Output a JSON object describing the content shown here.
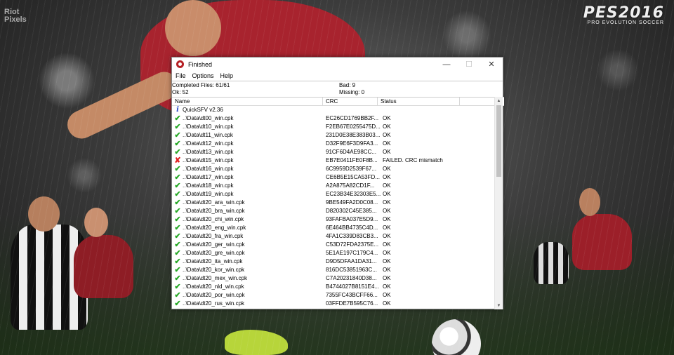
{
  "brand": {
    "title": "PES2016",
    "subtitle": "PRO EVOLUTION SOCCER"
  },
  "watermark": {
    "line1": "Riot",
    "line2": "Pixels"
  },
  "window": {
    "title": "Finished",
    "controls": {
      "minimize": "—",
      "maximize": "☐",
      "close": "✕"
    }
  },
  "menu": {
    "file": "File",
    "options": "Options",
    "help": "Help"
  },
  "stats": {
    "completed": "Completed Files: 61/61",
    "ok": "Ok: 52",
    "bad": "Bad: 9",
    "missing": "Missing: 0"
  },
  "columns": {
    "name": "Name",
    "crc": "CRC",
    "status": "Status"
  },
  "rows": [
    {
      "icon": "info-icon",
      "name": "QuickSFV v2.36",
      "crc": "",
      "status": ""
    },
    {
      "icon": "check-icon",
      "name": "..\\Data\\dt00_win.cpk",
      "crc": "EC26CD1769BB2F...",
      "status": "OK"
    },
    {
      "icon": "check-icon",
      "name": "..\\Data\\dt10_win.cpk",
      "crc": "F2EB67E0255475D...",
      "status": "OK"
    },
    {
      "icon": "check-icon",
      "name": "..\\Data\\dt11_win.cpk",
      "crc": "231D0E38E383B03...",
      "status": "OK"
    },
    {
      "icon": "check-icon",
      "name": "..\\Data\\dt12_win.cpk",
      "crc": "D32F9E6F3D9FA3...",
      "status": "OK"
    },
    {
      "icon": "check-icon",
      "name": "..\\Data\\dt13_win.cpk",
      "crc": "91CF6D4AE98CC...",
      "status": "OK"
    },
    {
      "icon": "cross-icon",
      "name": "..\\Data\\dt15_win.cpk",
      "crc": "EB7E0411FE0F8B...",
      "status": "FAILED.  CRC mismatch"
    },
    {
      "icon": "check-icon",
      "name": "..\\Data\\dt16_win.cpk",
      "crc": "6C9959D2539F67...",
      "status": "OK"
    },
    {
      "icon": "check-icon",
      "name": "..\\Data\\dt17_win.cpk",
      "crc": "CE6B5E15CA53FD...",
      "status": "OK"
    },
    {
      "icon": "check-icon",
      "name": "..\\Data\\dt18_win.cpk",
      "crc": "A2A875A82CD1F...",
      "status": "OK"
    },
    {
      "icon": "check-icon",
      "name": "..\\Data\\dt19_win.cpk",
      "crc": "EC23B34E32303E5...",
      "status": "OK"
    },
    {
      "icon": "check-icon",
      "name": "..\\Data\\dt20_ara_win.cpk",
      "crc": "9BE549FA2D0C08...",
      "status": "OK"
    },
    {
      "icon": "check-icon",
      "name": "..\\Data\\dt20_bra_win.cpk",
      "crc": "D820302C45E385...",
      "status": "OK"
    },
    {
      "icon": "check-icon",
      "name": "..\\Data\\dt20_chi_win.cpk",
      "crc": "93FAFBA037E5D9...",
      "status": "OK"
    },
    {
      "icon": "check-icon",
      "name": "..\\Data\\dt20_eng_win.cpk",
      "crc": "6E464BB4735C4D...",
      "status": "OK"
    },
    {
      "icon": "check-icon",
      "name": "..\\Data\\dt20_fra_win.cpk",
      "crc": "4FA1C339D83CB3...",
      "status": "OK"
    },
    {
      "icon": "check-icon",
      "name": "..\\Data\\dt20_ger_win.cpk",
      "crc": "C53D72FDA2375E...",
      "status": "OK"
    },
    {
      "icon": "check-icon",
      "name": "..\\Data\\dt20_gre_win.cpk",
      "crc": "5E1AE197C179C4...",
      "status": "OK"
    },
    {
      "icon": "check-icon",
      "name": "..\\Data\\dt20_ita_win.cpk",
      "crc": "D9D5DFAA1DA31...",
      "status": "OK"
    },
    {
      "icon": "check-icon",
      "name": "..\\Data\\dt20_kor_win.cpk",
      "crc": "816DC53851963C...",
      "status": "OK"
    },
    {
      "icon": "check-icon",
      "name": "..\\Data\\dt20_mex_win.cpk",
      "crc": "C7A20231840D38...",
      "status": "OK"
    },
    {
      "icon": "check-icon",
      "name": "..\\Data\\dt20_nld_win.cpk",
      "crc": "B4744027B8151E4...",
      "status": "OK"
    },
    {
      "icon": "check-icon",
      "name": "..\\Data\\dt20_por_win.cpk",
      "crc": "7355FC43BCFF66...",
      "status": "OK"
    },
    {
      "icon": "check-icon",
      "name": "..\\Data\\dt20_rus_win.cpk",
      "crc": "03FFDE7B595C76...",
      "status": "OK"
    }
  ]
}
